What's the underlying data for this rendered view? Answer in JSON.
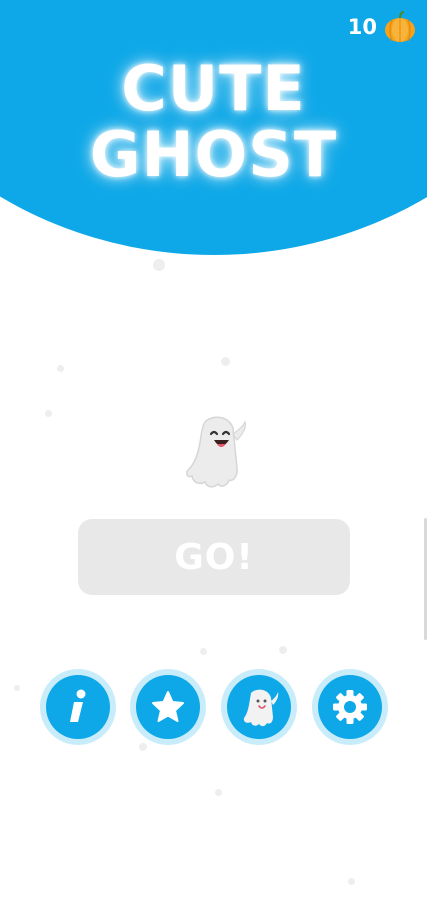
{
  "header": {
    "title_line1": "CUTE",
    "title_line2": "GHOST",
    "background_color": "#0ea8e8"
  },
  "currency": {
    "count": "10",
    "icon": "pumpkin-icon"
  },
  "play": {
    "label": "GO!",
    "hero_icon": "ghost-icon"
  },
  "menu": [
    {
      "name": "info",
      "icon": "info-icon"
    },
    {
      "name": "favorites",
      "icon": "star-icon"
    },
    {
      "name": "characters",
      "icon": "ghost-icon"
    },
    {
      "name": "settings",
      "icon": "gear-icon"
    }
  ],
  "colors": {
    "accent": "#0ea8e8",
    "button_ring": "#c9ecfb",
    "go_button": "#e8e8e8",
    "pumpkin": "#f5a31a"
  }
}
